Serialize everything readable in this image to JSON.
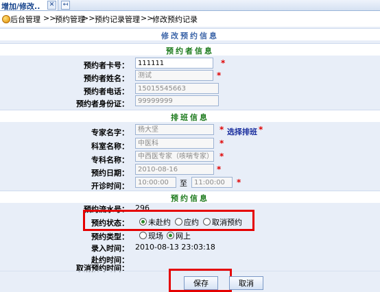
{
  "tab": {
    "label": "增加/修改..",
    "close_glyph": "✕",
    "new_glyph": "↤"
  },
  "breadcrumb": [
    "后台管理",
    ">>",
    "预约管理",
    ">>",
    "预约记录管理",
    ">>",
    "修改预约记录"
  ],
  "headers": {
    "page": "修改预约信息",
    "booker": "预约者信息",
    "schedule": "排班信息",
    "appointment": "预约信息"
  },
  "booker": {
    "card_label": "预约者卡号：",
    "card_value": "111111",
    "name_label": "预约者姓名：",
    "name_value": "测试",
    "phone_label": "预约者电话：",
    "phone_value": "15015545663",
    "id_label": "预约者身份证：",
    "id_value": "99999999"
  },
  "schedule": {
    "expert_label": "专家名字：",
    "expert_value": "杨大坚",
    "select_link": "选择排班",
    "dept_label": "科室名称：",
    "dept_value": "中医科",
    "specialty_label": "专科名称：",
    "specialty_value": "中西医专家（咳喘专家）",
    "date_label": "预约日期：",
    "date_value": "2010-08-16",
    "time_label": "开诊时间：",
    "time_start": "10:00:00",
    "time_to": "至",
    "time_end": "11:00:00"
  },
  "appointment": {
    "serial_label": "预约流水号：",
    "serial_value": "296",
    "status_label": "预约状态：",
    "status_options": [
      "未赴约",
      "应约",
      "取消预约"
    ],
    "status_selected": "未赴约",
    "type_label": "预约类型：",
    "type_options": [
      "现场",
      "网上"
    ],
    "type_selected": "网上",
    "entry_time_label": "录入时间：",
    "entry_time_value": "2010-08-13  23:03:18",
    "arrive_time_label": "赴约时间：",
    "cancel_time_label": "取消预约时间："
  },
  "required_mark": "*",
  "buttons": {
    "save": "保存",
    "cancel": "取消"
  },
  "colors": {
    "required": "#e00000",
    "highlight_box": "#e50000",
    "section_title": "#1c7a1c",
    "page_title": "#3b64a8"
  }
}
